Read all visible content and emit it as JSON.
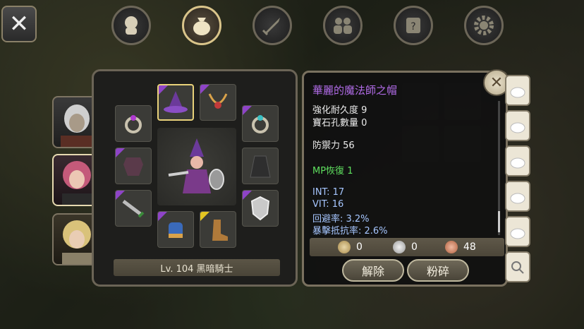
{
  "nav": {
    "close_label": "✕",
    "tabs": [
      "character-tab",
      "inventory-tab",
      "skills-tab",
      "party-tab",
      "quest-tab",
      "settings-tab"
    ]
  },
  "equip": {
    "level_text": "Lv. 104 黑暗騎士",
    "slots": [
      "hat",
      "necklace",
      "ring",
      "ring",
      "armor",
      "cape",
      "weapon",
      "shield",
      "gloves",
      "boots"
    ]
  },
  "item": {
    "name": "華麗的魔法師之帽",
    "durability": "強化耐久度 9",
    "sockets": "寶石孔數量 0",
    "defense": "防禦力 56",
    "mp_recovery": "MP恢復 1",
    "int": "INT: 17",
    "vit": "VIT: 16",
    "evade": "回避率: 3.2%",
    "crit_resist": "暴擊抵抗率: 2.6%"
  },
  "currency": {
    "gold": "0",
    "silver": "0",
    "copper": "48"
  },
  "buttons": {
    "unequip": "解除",
    "smash": "粉碎"
  },
  "colors": {
    "title": "#b06be6",
    "green": "#5fe05f",
    "stat": "#a6c6ff",
    "rarity_epic": "#8e44c7",
    "rarity_rare": "#e3c521"
  }
}
